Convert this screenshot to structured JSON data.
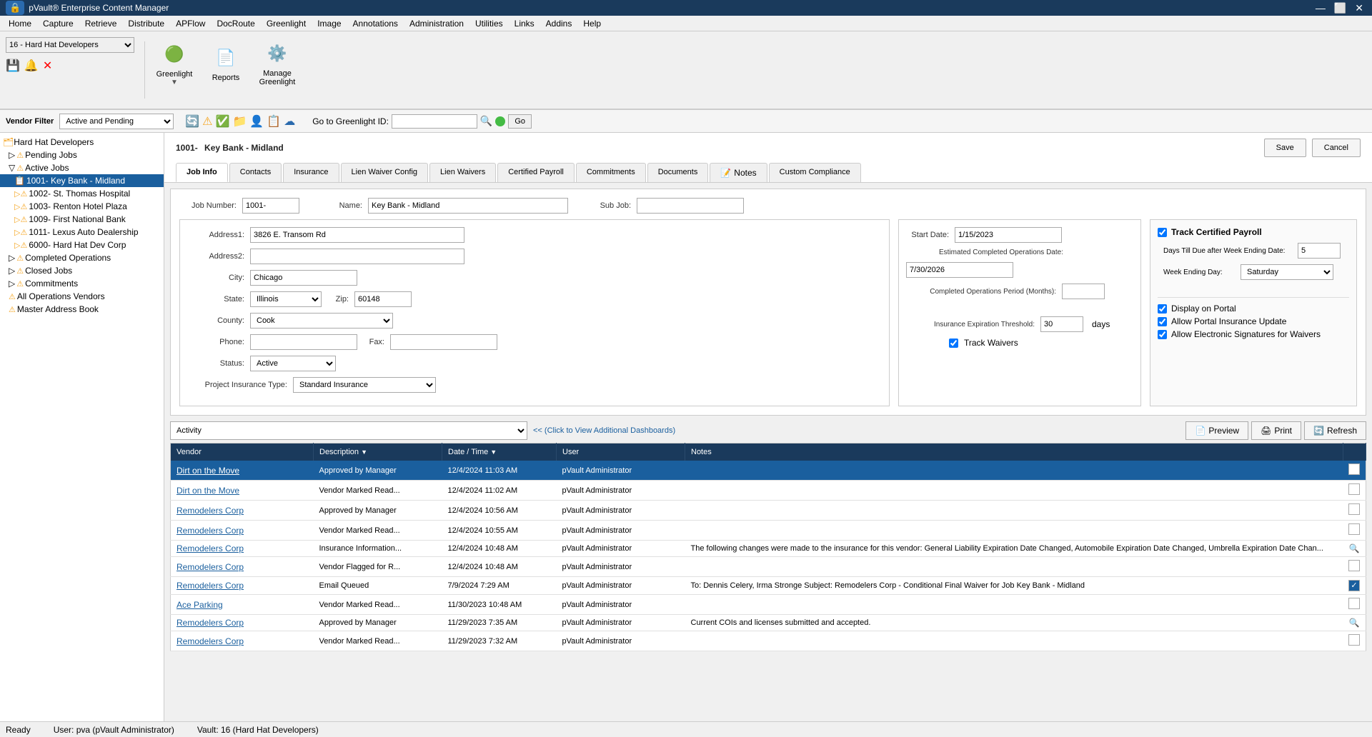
{
  "titlebar": {
    "title": "pVault® Enterprise Content Manager",
    "logo": "🔒",
    "brand": "pVault®"
  },
  "menubar": {
    "items": [
      "Home",
      "Capture",
      "Retrieve",
      "Distribute",
      "APFlow",
      "DocRoute",
      "Greenlight",
      "Image",
      "Annotations",
      "Administration",
      "Utilities",
      "Links",
      "Addins",
      "Help"
    ]
  },
  "toolbar": {
    "buttons": [
      {
        "label": "Greenlight",
        "icon": "🟢"
      },
      {
        "label": "Reports",
        "icon": "📄"
      },
      {
        "label": "Manage\nGreenlight",
        "icon": "⚙️"
      }
    ]
  },
  "subtoolbar": {
    "vendor_filter_label": "Vendor Filter",
    "filter_value": "Active and Pending",
    "greenlight_id_label": "Go to Greenlight ID:",
    "go_label": "Go"
  },
  "sidebar": {
    "root_label": "Hard Hat Developers",
    "items": [
      {
        "label": "Pending Jobs",
        "indent": 1,
        "type": "warning"
      },
      {
        "label": "Active Jobs",
        "indent": 1,
        "type": "warning"
      },
      {
        "label": "1001- Key Bank - Midland",
        "indent": 2,
        "type": "active",
        "selected": true
      },
      {
        "label": "1002- St. Thomas Hospital",
        "indent": 2,
        "type": "warning"
      },
      {
        "label": "1003- Renton Hotel Plaza",
        "indent": 2,
        "type": "warning"
      },
      {
        "label": "1009- First National Bank",
        "indent": 2,
        "type": "warning"
      },
      {
        "label": "1011- Lexus Auto Dealership",
        "indent": 2,
        "type": "warning"
      },
      {
        "label": "6000- Hard Hat Dev Corp",
        "indent": 2,
        "type": "warning"
      },
      {
        "label": "Completed Operations",
        "indent": 1,
        "type": "warning"
      },
      {
        "label": "Closed Jobs",
        "indent": 1,
        "type": "warning"
      },
      {
        "label": "Commitments",
        "indent": 1,
        "type": "warning"
      },
      {
        "label": "All Operations Vendors",
        "indent": 1,
        "type": "warning"
      },
      {
        "label": "Master Address Book",
        "indent": 1,
        "type": "warning"
      }
    ]
  },
  "page": {
    "job_prefix": "1001-",
    "job_name": "Key Bank - Midland",
    "save_label": "Save",
    "cancel_label": "Cancel",
    "tabs": [
      {
        "label": "Job Info",
        "active": true
      },
      {
        "label": "Contacts"
      },
      {
        "label": "Insurance"
      },
      {
        "label": "Lien Waiver Config"
      },
      {
        "label": "Lien Waivers"
      },
      {
        "label": "Certified Payroll"
      },
      {
        "label": "Commitments"
      },
      {
        "label": "Documents"
      },
      {
        "label": "Notes",
        "has_icon": true
      },
      {
        "label": "Custom Compliance"
      }
    ]
  },
  "job_info": {
    "job_number_label": "Job Number:",
    "job_number_value": "1001-",
    "name_label": "Name:",
    "name_value": "Key Bank - Midland",
    "sub_job_label": "Sub Job:",
    "sub_job_value": "",
    "address1_label": "Address1:",
    "address1_value": "3826 E. Transom Rd",
    "address2_label": "Address2:",
    "address2_value": "",
    "city_label": "City:",
    "city_value": "Chicago",
    "state_label": "State:",
    "state_value": "Illinois",
    "zip_label": "Zip:",
    "zip_value": "60148",
    "county_label": "County:",
    "county_value": "Cook",
    "phone_label": "Phone:",
    "phone_value": "",
    "fax_label": "Fax:",
    "fax_value": "",
    "status_label": "Status:",
    "status_value": "Active",
    "project_insurance_label": "Project Insurance Type:",
    "project_insurance_value": "Standard Insurance",
    "start_date_label": "Start Date:",
    "start_date_value": "1/15/2023",
    "est_completed_label": "Estimated Completed Operations Date:",
    "est_completed_value": "7/30/2026",
    "completed_period_label": "Completed Operations Period (Months):",
    "completed_period_value": "",
    "insurance_threshold_label": "Insurance Expiration Threshold:",
    "insurance_threshold_value": "30",
    "insurance_threshold_suffix": "days",
    "track_waivers_label": "Track Waivers",
    "track_certified_label": "Track Certified Payroll",
    "days_till_due_label": "Days Till Due after Week Ending Date:",
    "days_till_due_value": "5",
    "week_ending_day_label": "Week Ending Day:",
    "week_ending_day_value": "Saturday",
    "display_portal_label": "Display on Portal",
    "allow_portal_label": "Allow Portal Insurance Update",
    "allow_electronic_label": "Allow Electronic Signatures for Waivers"
  },
  "dashboard": {
    "select_value": "Activity",
    "additional_dashboards_label": "<< (Click to View Additional Dashboards)",
    "preview_label": "Preview",
    "print_label": "Print",
    "refresh_label": "Refresh",
    "table": {
      "headers": [
        "Vendor",
        "Description",
        "Date / Time",
        "User",
        "Notes",
        ""
      ],
      "rows": [
        {
          "vendor": "Dirt on the Move",
          "description": "Approved by Manager",
          "datetime": "12/4/2024 11:03 AM",
          "user": "pVault Administrator",
          "notes": "",
          "has_check": true,
          "selected": true
        },
        {
          "vendor": "Dirt on the Move",
          "description": "Vendor Marked Read...",
          "datetime": "12/4/2024 11:02 AM",
          "user": "pVault Administrator",
          "notes": "",
          "has_check": false
        },
        {
          "vendor": "Remodelers Corp",
          "description": "Approved by Manager",
          "datetime": "12/4/2024 10:56 AM",
          "user": "pVault Administrator",
          "notes": "",
          "has_check": false
        },
        {
          "vendor": "Remodelers Corp",
          "description": "Vendor Marked Read...",
          "datetime": "12/4/2024 10:55 AM",
          "user": "pVault Administrator",
          "notes": "",
          "has_check": false
        },
        {
          "vendor": "Remodelers Corp",
          "description": "Insurance Information...",
          "datetime": "12/4/2024 10:48 AM",
          "user": "pVault Administrator",
          "notes": "The following changes were made to the insurance for this vendor: General Liability Expiration Date Changed, Automobile Expiration Date Changed, Umbrella Expiration Date Chan...",
          "has_search": true
        },
        {
          "vendor": "Remodelers Corp",
          "description": "Vendor Flagged for R...",
          "datetime": "12/4/2024 10:48 AM",
          "user": "pVault Administrator",
          "notes": "",
          "has_check": false
        },
        {
          "vendor": "Remodelers Corp",
          "description": "Email Queued",
          "datetime": "7/9/2024 7:29 AM",
          "user": "pVault Administrator",
          "notes": "To: Dennis Celery, Irma Stronge   Subject: Remodelers Corp - Conditional Final Waiver for Job Key Bank - Midland",
          "has_check": true,
          "check_blue": true
        },
        {
          "vendor": "Ace Parking",
          "description": "Vendor Marked Read...",
          "datetime": "11/30/2023 10:48 AM",
          "user": "pVault Administrator",
          "notes": "",
          "has_check": false
        },
        {
          "vendor": "Remodelers Corp",
          "description": "Approved by Manager",
          "datetime": "11/29/2023 7:35 AM",
          "user": "pVault Administrator",
          "notes": "Current COIs and licenses submitted and accepted.",
          "has_search": true
        },
        {
          "vendor": "Remodelers Corp",
          "description": "Vendor Marked Read...",
          "datetime": "11/29/2023 7:32 AM",
          "user": "pVault Administrator",
          "notes": "",
          "has_check": false
        }
      ]
    }
  },
  "statusbar": {
    "ready": "Ready",
    "user": "User: pva (pVault Administrator)",
    "vault": "Vault: 16 (Hard Hat Developers)"
  }
}
